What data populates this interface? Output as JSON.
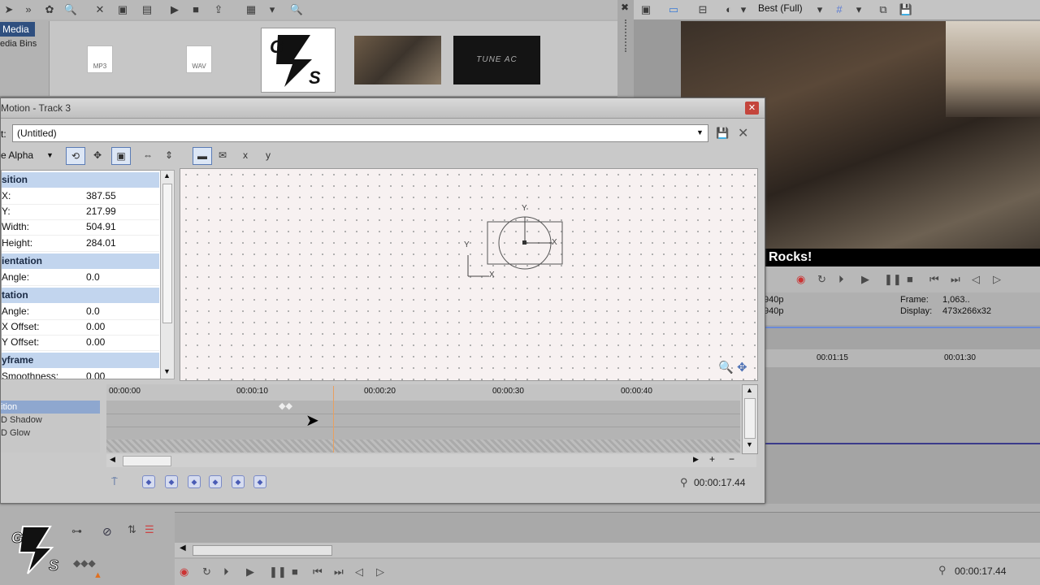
{
  "media_panel": {
    "tab_label": "Media",
    "bins_label": "edia Bins",
    "thumbs": [
      {
        "type": "MP3",
        "name": "mp3-file"
      },
      {
        "type": "WAV",
        "name": "wav-file"
      }
    ],
    "gs_logo_text": "GS",
    "thumb2_text": "TUNE AC"
  },
  "preview": {
    "quality": "Best (Full)",
    "overlay_text": "Rocks!",
    "info_left_1": "940p",
    "info_left_2": "940p",
    "frame_label": "Frame:",
    "frame_value": "1,063..",
    "display_label": "Display:",
    "display_value": "473x266x32"
  },
  "timeline_right": {
    "ticks": [
      "00:01:15",
      "00:01:30"
    ]
  },
  "dialog": {
    "title": "Motion - Track 3",
    "preset_label": "t:",
    "preset_value": "(Untitled)",
    "alpha_label": "e Alpha",
    "properties": {
      "position_cat": "sition",
      "x_label": "X:",
      "x_value": "387.55",
      "y_label": "Y:",
      "y_value": "217.99",
      "width_label": "Width:",
      "width_value": "504.91",
      "height_label": "Height:",
      "height_value": "284.01",
      "orientation_cat": "ientation",
      "orient_angle_label": "Angle:",
      "orient_angle_value": "0.0",
      "rotation_cat": "tation",
      "rot_angle_label": "Angle:",
      "rot_angle_value": "0.0",
      "x_offset_label": "X Offset:",
      "x_offset_value": "0.00",
      "y_offset_label": "Y Offset:",
      "y_offset_value": "0.00",
      "keyframe_cat": "yframe",
      "smoothness_label": "Smoothness:",
      "smoothness_value": "0.00"
    },
    "canvas_labels": {
      "y_axis": "Y",
      "x_axis": "X",
      "y_local": "Y",
      "x_local": "X"
    },
    "ruler_ticks": [
      "00:00:00",
      "00:00:10",
      "00:00:20",
      "00:00:30",
      "00:00:40"
    ],
    "tracks": [
      "ition",
      "D Shadow",
      "D Glow"
    ],
    "time": "00:00:17.44"
  },
  "bottom": {
    "time": "00:00:17.44"
  }
}
